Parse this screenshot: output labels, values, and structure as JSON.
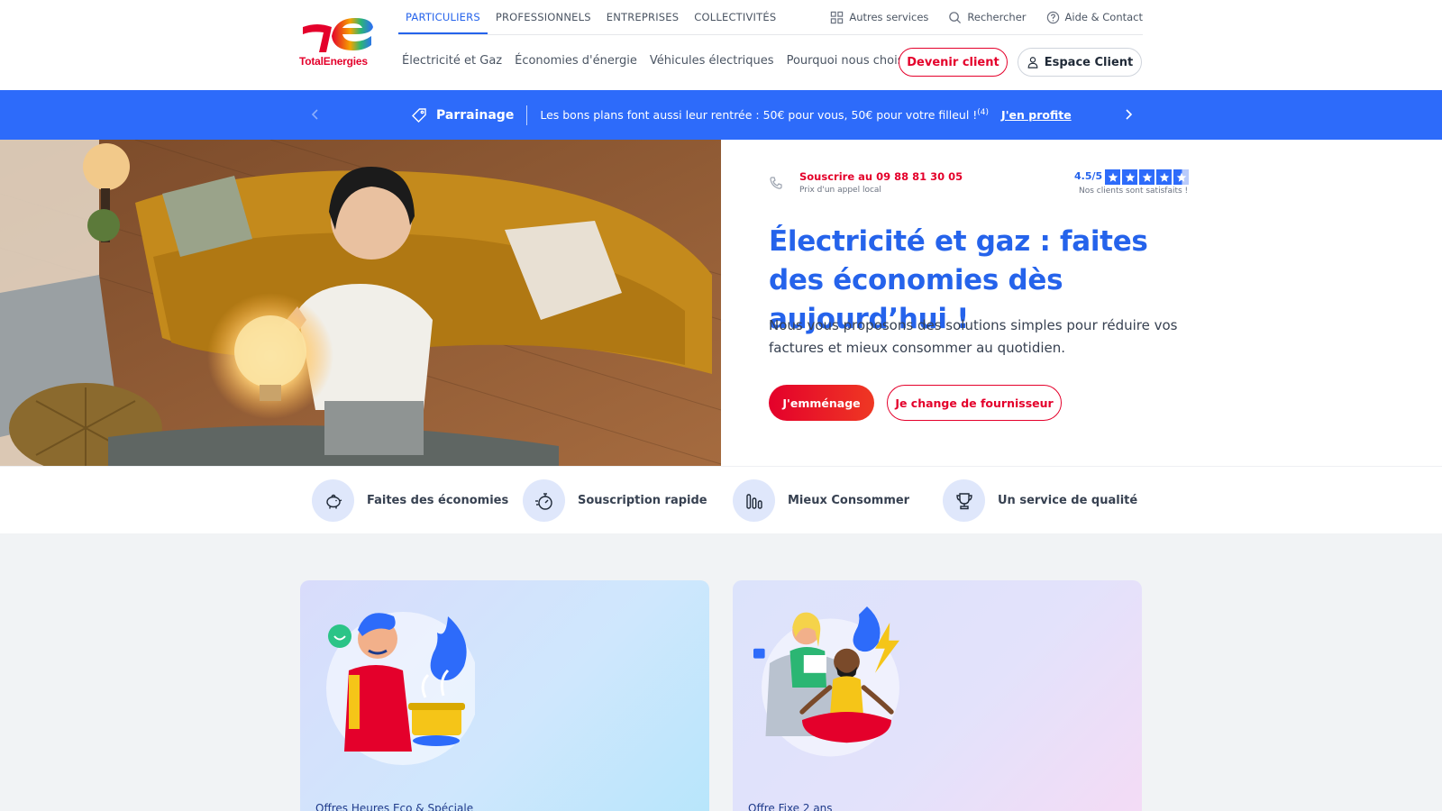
{
  "brand": {
    "logo_text": "TotalEnergies",
    "colors": {
      "red": "#e4002b",
      "blue": "#2d6bfa",
      "dark_blue": "#2563eb",
      "yellow": "#ffd200"
    }
  },
  "header": {
    "top_tabs": [
      "PARTICULIERS",
      "PROFESSIONNELS",
      "ENTREPRISES",
      "COLLECTIVITÉS"
    ],
    "active_tab": "PARTICULIERS",
    "utilities": [
      {
        "label": "Autres services",
        "icon": "grid-icon"
      },
      {
        "label": "Rechercher",
        "icon": "search-icon"
      },
      {
        "label": "Aide & Contact",
        "icon": "help-circle-icon"
      }
    ],
    "sub_nav": [
      "Électricité et Gaz",
      "Économies d'énergie",
      "Véhicules électriques",
      "Pourquoi nous choisir"
    ],
    "devenir_client": "Devenir client",
    "espace_client": "Espace Client"
  },
  "banner": {
    "tag_icon": "tag-icon",
    "title": "Parrainage",
    "text": "Les bons plans font aussi leur rentrée : 50€ pour vous, 50€ pour votre filleul !",
    "footnote": "(4)",
    "link": "J'en profite"
  },
  "hero": {
    "phone_text": "Souscrire au 09 88 81 30 05",
    "phone_sub": "Prix d'un appel local",
    "rating": "4.5/5",
    "rating_value": 4.5,
    "rating_max": 5,
    "rating_sub": "Nos clients sont satisfaits !",
    "title": "Électricité et gaz : faites des économies dès aujourd’hui !",
    "description": "Nous vous proposons des solutions simples pour réduire vos factures et mieux consommer au quotidien.",
    "cta_primary": "J'emménage",
    "cta_secondary": "Je change de fournisseur"
  },
  "features": [
    {
      "label": "Faites des économies",
      "icon": "piggy-bank-icon"
    },
    {
      "label": "Souscription rapide",
      "icon": "stopwatch-icon"
    },
    {
      "label": "Mieux Consommer",
      "icon": "bar-chart-icon"
    },
    {
      "label": "Un service de qualité",
      "icon": "trophy-icon"
    }
  ],
  "offers": [
    {
      "label": "Offres Heures Eco & Spéciale"
    },
    {
      "label": "Offre Fixe 2 ans"
    }
  ]
}
